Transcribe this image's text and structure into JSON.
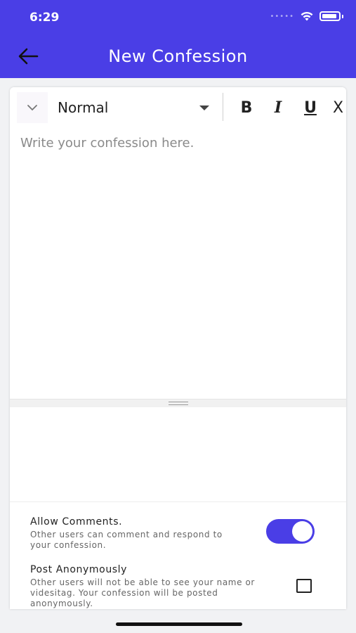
{
  "status_bar": {
    "time": "6:29",
    "signal": "•••••"
  },
  "header": {
    "title": "New Confession",
    "back_icon": "arrow-left-icon"
  },
  "toolbar": {
    "collapse_icon": "chevron-down-icon",
    "style_value": "Normal",
    "bold_label": "B",
    "italic_label": "I",
    "underline_label": "U",
    "more_label": "X"
  },
  "editor": {
    "placeholder": "Write your confession here."
  },
  "options": {
    "allow_comments": {
      "title": "Allow Comments.",
      "description": "Other users can comment and respond to your confession.",
      "enabled": true
    },
    "post_anonymously": {
      "title": "Post Anonymously",
      "description": "Other users will not be able to see your name or videsitag. Your confession will be posted anonymously.",
      "checked": false
    }
  },
  "colors": {
    "accent": "#4a3ee6",
    "background": "#f1f2f4"
  }
}
